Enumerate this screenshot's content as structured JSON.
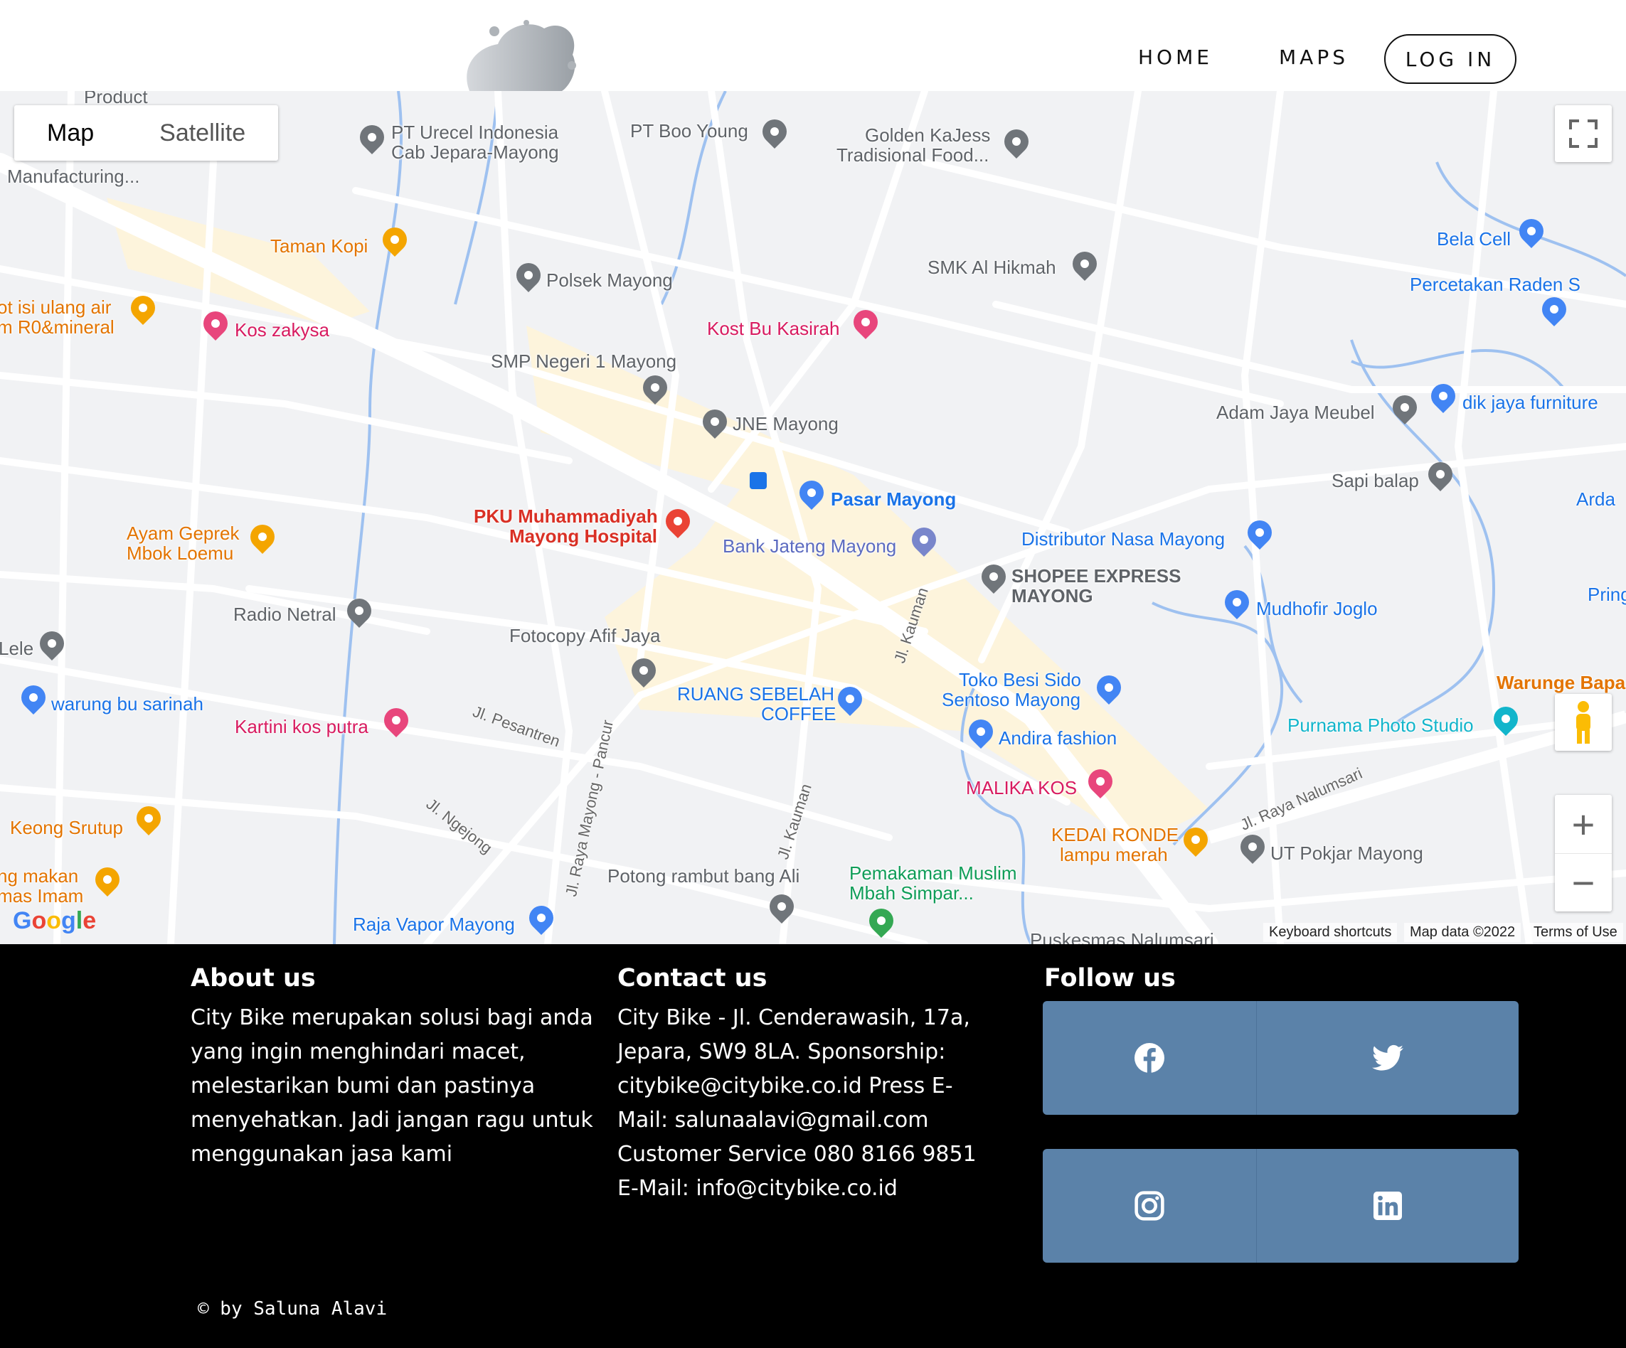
{
  "nav": {
    "home": "HOME",
    "maps": "MAPS",
    "login": "LOG IN"
  },
  "map": {
    "type_map": "Map",
    "type_satellite": "Satellite",
    "attribution": {
      "keyboard": "Keyboard shortcuts",
      "data": "Map data ©2022",
      "terms": "Terms of Use"
    },
    "google_logo": "Google",
    "zoom_in": "+",
    "zoom_out": "−",
    "pois": [
      {
        "name": "Product",
        "color": "#5f6368"
      },
      {
        "name": "PT Urecel Indonesia",
        "color": "#5f6368"
      },
      {
        "name": "Cab Jepara-Mayong",
        "color": "#5f6368"
      },
      {
        "name": "PT Boo Young",
        "color": "#5f6368"
      },
      {
        "name": "Golden KaJess",
        "color": "#5f6368"
      },
      {
        "name": "Tradisional Food...",
        "color": "#5f6368"
      },
      {
        "name": "Manufacturing...",
        "color": "#5f6368"
      },
      {
        "name": "Taman Kopi",
        "color": "#e37400"
      },
      {
        "name": "Polsek Mayong",
        "color": "#5f6368"
      },
      {
        "name": "SMK Al Hikmah",
        "color": "#5f6368"
      },
      {
        "name": "Bela Cell",
        "color": "#1a73e8"
      },
      {
        "name": "Percetakan Raden S",
        "color": "#1a73e8"
      },
      {
        "name": "ot isi ulang air",
        "color": "#e37400"
      },
      {
        "name": "m R0&mineral",
        "color": "#e37400"
      },
      {
        "name": "Kos zakysa",
        "color": "#d81b60"
      },
      {
        "name": "Kost Bu Kasirah",
        "color": "#d81b60"
      },
      {
        "name": "SMP Negeri 1 Mayong",
        "color": "#5f6368"
      },
      {
        "name": "JNE Mayong",
        "color": "#5f6368"
      },
      {
        "name": "Adam Jaya Meubel",
        "color": "#5f6368"
      },
      {
        "name": "dik jaya furniture",
        "color": "#1a73e8"
      },
      {
        "name": "Sapi balap",
        "color": "#5f6368"
      },
      {
        "name": "Arda",
        "color": "#1a73e8"
      },
      {
        "name": "Pasar Mayong",
        "color": "#1a73e8"
      },
      {
        "name": "PKU Muhammadiyah",
        "color": "#d93025"
      },
      {
        "name": "Mayong Hospital",
        "color": "#d93025"
      },
      {
        "name": "Ayam Geprek",
        "color": "#e37400"
      },
      {
        "name": "Mbok Loemu",
        "color": "#e37400"
      },
      {
        "name": "Bank Jateng Mayong",
        "color": "#5c6bc0"
      },
      {
        "name": "Distributor Nasa Mayong",
        "color": "#1a73e8"
      },
      {
        "name": "SHOPEE EXPRESS",
        "color": "#5f6368"
      },
      {
        "name": "MAYONG",
        "color": "#5f6368"
      },
      {
        "name": "Mudhofir Joglo",
        "color": "#1a73e8"
      },
      {
        "name": "Pring",
        "color": "#1a73e8"
      },
      {
        "name": "Radio Netral",
        "color": "#5f6368"
      },
      {
        "name": "Lele",
        "color": "#5f6368"
      },
      {
        "name": "Fotocopy Afif Jaya",
        "color": "#5f6368"
      },
      {
        "name": "RUANG SEBELAH",
        "color": "#1a73e8"
      },
      {
        "name": "COFFEE",
        "color": "#1a73e8"
      },
      {
        "name": "Toko Besi Sido",
        "color": "#1a73e8"
      },
      {
        "name": "Sentoso Mayong",
        "color": "#1a73e8"
      },
      {
        "name": "Warunge Bapa",
        "color": "#e37400"
      },
      {
        "name": "warung bu sarinah",
        "color": "#1a73e8"
      },
      {
        "name": "Kartini kos putra",
        "color": "#d81b60"
      },
      {
        "name": "Andira fashion",
        "color": "#1a73e8"
      },
      {
        "name": "Purnama Photo Studio",
        "color": "#12b5cb"
      },
      {
        "name": "MALIKA KOS",
        "color": "#d81b60"
      },
      {
        "name": "Keong Srutup",
        "color": "#e37400"
      },
      {
        "name": "KEDAI RONDE",
        "color": "#e37400"
      },
      {
        "name": "lampu merah",
        "color": "#e37400"
      },
      {
        "name": "UT Pokjar Mayong",
        "color": "#5f6368"
      },
      {
        "name": "ng makan",
        "color": "#e37400"
      },
      {
        "name": "mas Imam",
        "color": "#e37400"
      },
      {
        "name": "Potong rambut bang Ali",
        "color": "#5f6368"
      },
      {
        "name": "Pemakaman Muslim",
        "color": "#0f9d58"
      },
      {
        "name": "Mbah Simpar...",
        "color": "#0f9d58"
      },
      {
        "name": "Raja Vapor Mayong",
        "color": "#1a73e8"
      },
      {
        "name": "Puskesmas Nalumsari",
        "color": "#5f6368"
      }
    ],
    "streets": [
      "Jl. Pesantren",
      "Jl. Ngejong",
      "Jl. Raya Mayong - Pancur",
      "Jl. Kauman",
      "Jl. Kauman",
      "Jl. Raya Nalumsari"
    ]
  },
  "footer": {
    "about_title": "About us",
    "about_text": "City Bike merupakan solusi bagi anda yang ingin menghindari macet, melestarikan bumi dan pastinya menyehatkan. Jadi jangan ragu untuk menggunakan jasa kami",
    "contact_title": "Contact us",
    "contact_text": "City Bike - Jl. Cenderawasih, 17a, Jepara, SW9 8LA. Sponsorship: citybike@citybike.co.id Press E-Mail: salunaalavi@gmail.com Customer Service 080 8166 9851 E-Mail: info@citybike.co.id",
    "follow_title": "Follow us",
    "social_icons": [
      "facebook-icon",
      "twitter-icon",
      "instagram-icon",
      "linkedin-icon"
    ],
    "social_color": "#5b82a9",
    "copyright": "© by Saluna Alavi"
  }
}
